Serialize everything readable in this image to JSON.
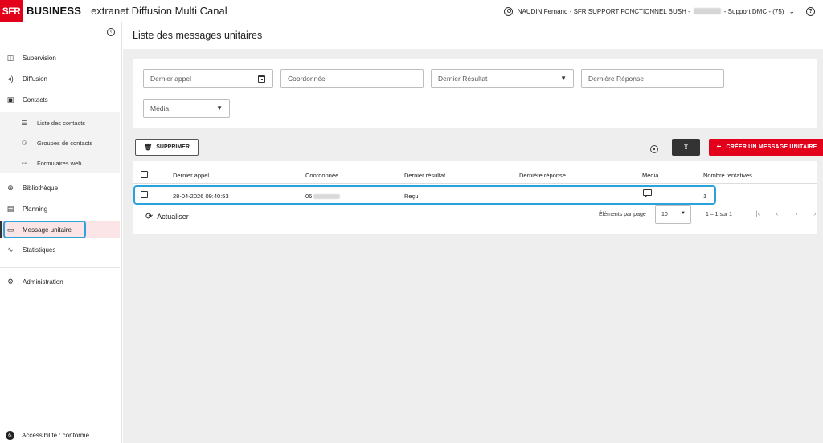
{
  "header": {
    "logo_sfr": "SFR",
    "logo_business": "BUSINESS",
    "app_title": "extranet Diffusion Multi Canal",
    "user_prefix": "NAUDIN Fernand - SFR SUPPORT FONCTIONNEL BUSH -",
    "user_suffix": "- Support DMC - (75)",
    "chevron": "⌄",
    "help": "?"
  },
  "sidebar": {
    "collapse_glyph": "‹",
    "items": [
      {
        "label": "Supervision",
        "icon": "◫"
      },
      {
        "label": "Diffusion",
        "icon": "◂)"
      },
      {
        "label": "Contacts",
        "icon": "▣"
      },
      {
        "label": "Bibliothèque",
        "icon": "⊕"
      },
      {
        "label": "Planning",
        "icon": "▤"
      },
      {
        "label": "Message unitaire",
        "icon": "▭"
      },
      {
        "label": "Statistiques",
        "icon": "∿"
      },
      {
        "label": "Administration",
        "icon": "⚙"
      }
    ],
    "contacts_sub": [
      {
        "label": "Liste des contacts",
        "icon": "☰"
      },
      {
        "label": "Groupes de contacts",
        "icon": "⚇"
      },
      {
        "label": "Formulaires web",
        "icon": "☷"
      }
    ],
    "accessibility": "Accessibilité : conforme",
    "accessibility_icon": "♿"
  },
  "page": {
    "title": "Liste des messages unitaires"
  },
  "filters": {
    "dernier_appel": "Dernier appel",
    "coordonnee": "Coordonnée",
    "dernier_resultat": "Dernier Résultat",
    "derniere_reponse": "Dernière Réponse",
    "media": "Média",
    "dropdown_arrow": "▼"
  },
  "toolbar": {
    "delete_label": "SUPPRIMER",
    "delete_icon": "🗑",
    "upload_icon": "⇪",
    "create_label": "CRÉER UN MESSAGE UNITAIRE",
    "create_plus": "+"
  },
  "table": {
    "columns": [
      "Dernier appel",
      "Coordonnée",
      "Dernier résultat",
      "Dernière réponse",
      "Média",
      "Nombre tentatives"
    ],
    "rows": [
      {
        "dernier_appel": "28-04-2026 09:40:53",
        "coordonnee": "06",
        "dernier_resultat": "Reçu",
        "derniere_reponse": "",
        "nombre_tentatives": "1"
      }
    ]
  },
  "footer": {
    "refresh_label": "Actualiser",
    "refresh_icon": "⟳",
    "per_page_label": "Éléments par page",
    "per_page_value": "10",
    "per_page_arrow": "▼",
    "range": "1 – 1 sur 1",
    "pager": [
      "|‹",
      "‹",
      "›",
      "›|"
    ]
  }
}
